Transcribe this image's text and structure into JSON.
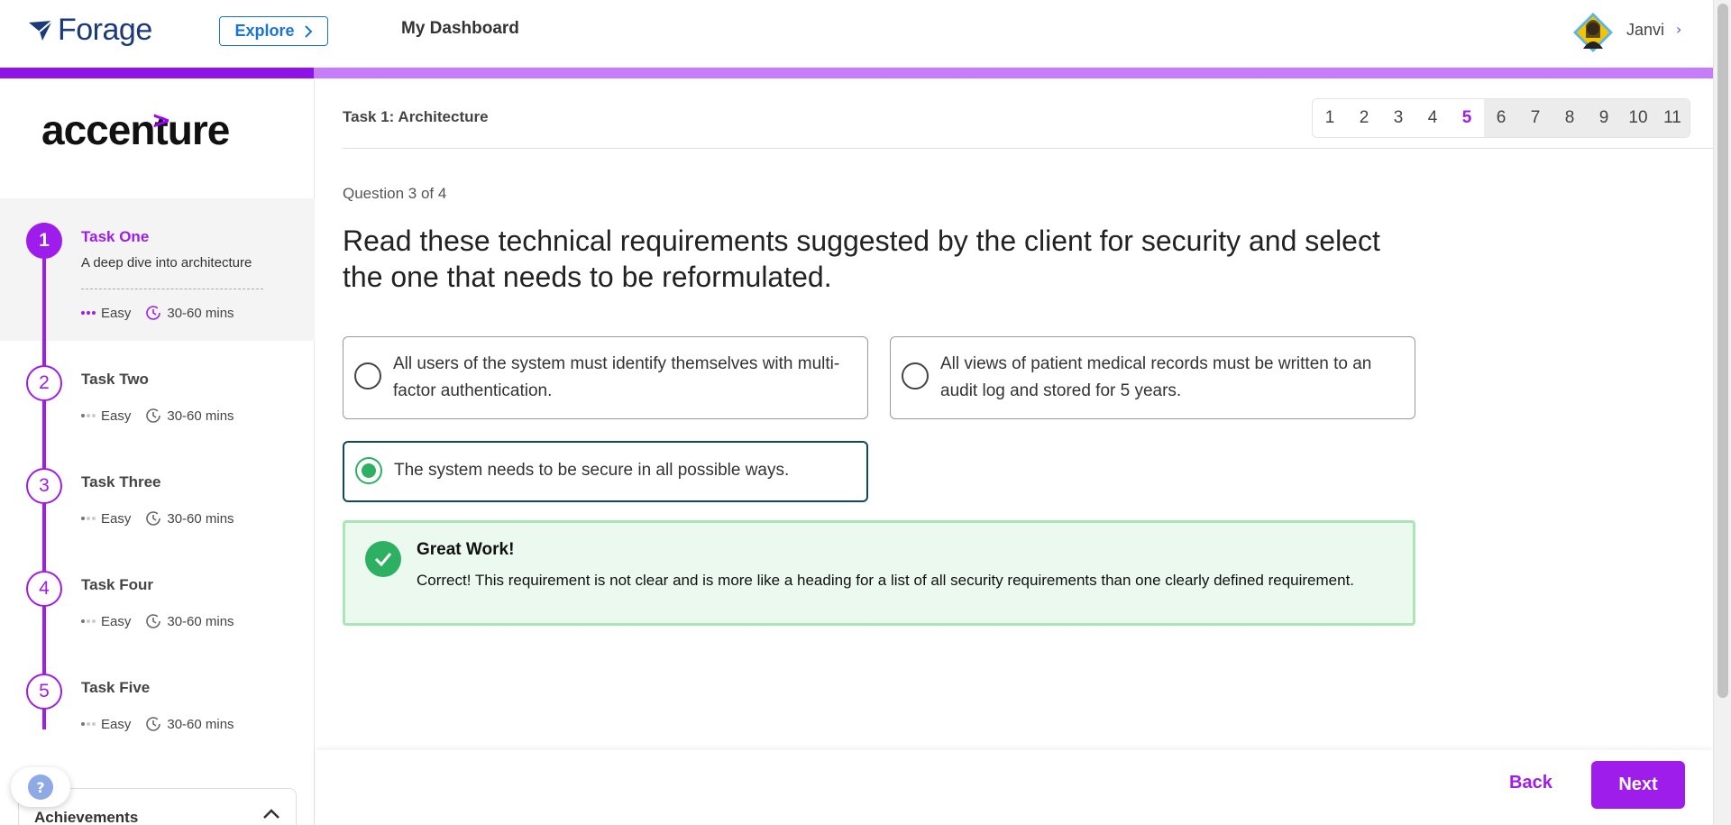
{
  "header": {
    "logo_text": "Forage",
    "explore_label": "Explore",
    "dashboard_label": "My Dashboard",
    "user_name": "Janvi",
    "user_chevron": "›"
  },
  "progress": {
    "percent": 18.3,
    "fill_color": "#8f13e8",
    "track_color": "#c77dfa"
  },
  "sidebar": {
    "brand_text": "accenture",
    "brand_mark": ">",
    "tasks": [
      {
        "number": "1",
        "title": "Task One",
        "description": "A deep dive into architecture",
        "difficulty": "Easy",
        "duration": "30-60 mins",
        "active": true
      },
      {
        "number": "2",
        "title": "Task Two",
        "difficulty": "Easy",
        "duration": "30-60 mins"
      },
      {
        "number": "3",
        "title": "Task Three",
        "difficulty": "Easy",
        "duration": "30-60 mins"
      },
      {
        "number": "4",
        "title": "Task Four",
        "difficulty": "Easy",
        "duration": "30-60 mins"
      },
      {
        "number": "5",
        "title": "Task Five",
        "difficulty": "Easy",
        "duration": "30-60 mins"
      }
    ],
    "help_icon": "?",
    "achievements_label": "Achievements"
  },
  "main": {
    "task_header": "Task 1: Architecture",
    "pages": [
      "1",
      "2",
      "3",
      "4",
      "5",
      "6",
      "7",
      "8",
      "9",
      "10",
      "11"
    ],
    "current_page": "5",
    "question_count": "Question 3 of 4",
    "question_text": "Read these technical requirements suggested by the client for security and select the one that needs to be reformulated.",
    "options": [
      {
        "text": "All users of the system must identify themselves with multi-factor authentication.",
        "selected": false
      },
      {
        "text": "All views of patient medical records must be written to an audit log and stored for 5 years.",
        "selected": false
      },
      {
        "text": "The system needs to be secure in all possible ways.",
        "selected": true
      }
    ],
    "feedback": {
      "title": "Great Work!",
      "text": "Correct! This requirement is not clear and is more like a heading for a list of all security requirements than one clearly defined requirement."
    },
    "back_label": "Back",
    "next_label": "Next"
  },
  "colors": {
    "accent": "#9f1dea",
    "success": "#2eb062",
    "brand_navy": "#1b3a7a",
    "link_blue": "#1a73d9"
  }
}
